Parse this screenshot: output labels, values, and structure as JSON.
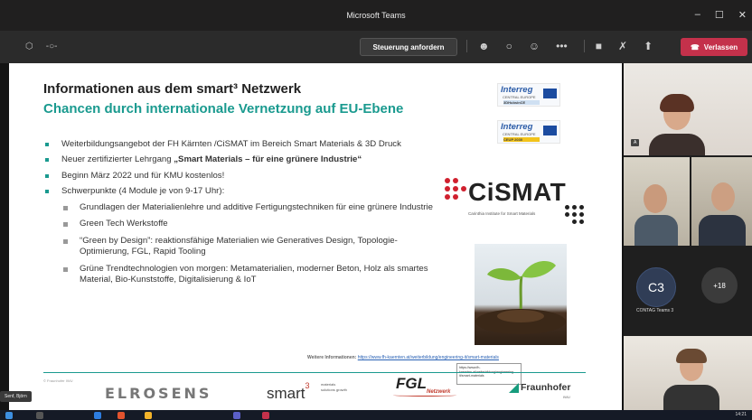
{
  "window": {
    "title": "Microsoft Teams",
    "minimize": "–",
    "maximize": "☐",
    "close": "✕"
  },
  "toolbar": {
    "control_button": "Steuerung anfordern",
    "leave_button": "Verlassen",
    "icons": [
      "people-icon",
      "chat-icon",
      "reactions-icon",
      "more-icon",
      "camera-icon",
      "mic-off-icon",
      "share-icon"
    ]
  },
  "slide": {
    "title": "Informationen aus dem smart³ Netzwerk",
    "subtitle": "Chancen durch internationale Vernetzung auf EU-Ebene",
    "bullets": [
      "Weiterbildungsangebot der FH Kärnten /CiSMAT im Bereich Smart Materials & 3D Druck",
      "Beginn März 2022 und für KMU kostenlos!",
      "Schwerpunkte (4 Module je von 9-17 Uhr):"
    ],
    "bullet2_prefix": "Neuer zertifizierter Lehrgang ",
    "bullet2_bold": "„Smart Materials – für eine grünere Industrie“",
    "subbullets": [
      "Grundlagen der Materialienlehre und additive Fertigungstechniken für eine grünere Industrie",
      "Green Tech Werkstoffe",
      "“Green by Design”: reaktionsfähige Materialien wie Generatives Design, Topologie-Optimierung, FGL, Rapid Tooling",
      "Grüne Trendtechnologien von morgen: Metamaterialien, moderner Beton, Holz als smartes Material, Bio-Kunststoffe, Digitalisierung & IoT"
    ],
    "interreg1": {
      "brand": "Interreg",
      "sub": "CENTRAL EUROPE",
      "tag": "3DHubsinCE"
    },
    "interreg2": {
      "brand": "Interreg",
      "sub": "CENTRAL EUROPE",
      "tag": "CEUP 2030"
    },
    "cismat_text": "CiSMAT",
    "cismat_sub": "Carinthia Institute for Smart Materials",
    "weitere_label": "Weitere Informationen:",
    "weitere_url": "https://www.fh-kaernten.at/weiterbildung/engineering-it/smart-materials",
    "tooltip": "https://www.fh-kaernten.at/weiterbildung/engineering-it/smart-materials",
    "copyright": "© Fraunhofer IWU",
    "logos": {
      "elrosens": "ELROSENS",
      "smart": "smart",
      "smart_sup": "3",
      "smart_sub": "materials solutions growth",
      "fgl": "FGL",
      "fgl_sub": "Netzwerk",
      "fraunhofer": "Fraunhofer",
      "fraunhofer_sub": "IWU"
    }
  },
  "participants": {
    "tile1_badge": "A",
    "c3_initials": "C3",
    "c3_label": "CONTAG Teams 3",
    "more": "+18"
  },
  "presenter_label": "Senf, Björn",
  "clock": "14:21"
}
